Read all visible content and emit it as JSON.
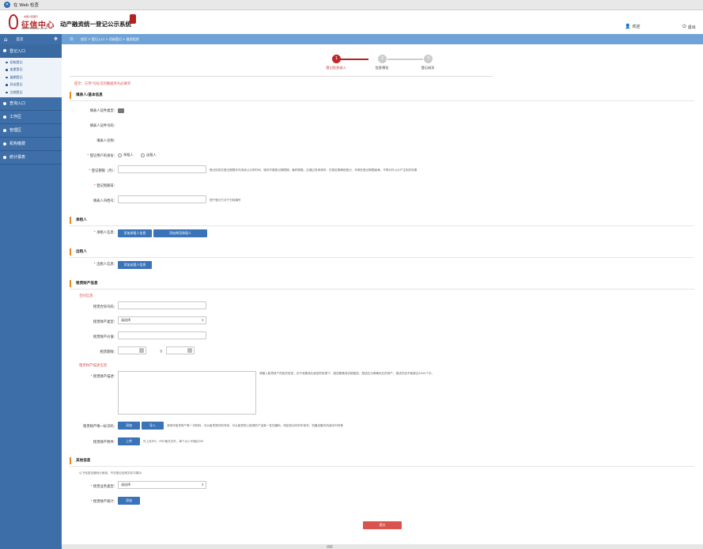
{
  "window": {
    "title": "在 Web 检查"
  },
  "header": {
    "logo_small": "中国人民银行",
    "logo_text": "征信中心",
    "logo_en": "CREDIT REFERENCE CENTER",
    "system_title": "动产融资统一登记公示系统",
    "user_label": "欢迎",
    "exit_label": "退出"
  },
  "nav": {
    "home_label": "首页",
    "breadcrumb": "首页 > 登记入口 > 初始登记 > 融资租赁"
  },
  "sidebar": {
    "groups": [
      {
        "label": "登记入口"
      },
      {
        "label": "查询入口"
      },
      {
        "label": "工作区"
      },
      {
        "label": "管理区"
      },
      {
        "label": "机构缴费"
      },
      {
        "label": "统计报表"
      }
    ],
    "sub_items": [
      {
        "label": "初始登记"
      },
      {
        "label": "变更登记"
      },
      {
        "label": "展期登记"
      },
      {
        "label": "异议登记"
      },
      {
        "label": "注销登记"
      }
    ]
  },
  "steps": [
    {
      "num": "1",
      "label": "登记信息录入"
    },
    {
      "num": "2",
      "label": "信息预览"
    },
    {
      "num": "3",
      "label": "登记成功"
    }
  ],
  "hint": "提示：方带*号标识的数据项为必填项",
  "sections": {
    "filler": "填表人/基本信息",
    "lessee": "承租人",
    "lessor": "出租人",
    "lease_property": "租赁财产信息",
    "other": "其他信息"
  },
  "filler": {
    "cert_type_label": "填表人证件类型：",
    "cert_no_label": "填表人证件号码：",
    "name_label": "填表人名称：",
    "role_label": "登记用户的身份：",
    "role_options": [
      "承租人",
      "出租人"
    ],
    "period_label": "登记期限（月）：",
    "period_help": "登记信息在登记期限年内持续公示的时间，服务开展登记期限期，最终期限。应通过查询请求，在规定期满前登记，本期在登记期限届满，不再对外公示产生相关效果",
    "expire_label": "登记到期日：",
    "ref_label": "填表人归档号：",
    "ref_help": "便于登记方对于归档编号"
  },
  "lessee": {
    "info_label": "承租人信息：",
    "btn_add_individual": "添加承租人信息",
    "btn_add_common": "添加常用承租人"
  },
  "lessor": {
    "info_label": "出租人信息：",
    "btn_add": "添加出租人信息"
  },
  "contract": {
    "sub_title": "合同信息",
    "contract_no_label": "租赁合同号码：",
    "type_label": "租赁财产类型：",
    "type_value": "请选择",
    "value_label": "租赁财产价值：",
    "term_label": "租赁期限：",
    "term_to": "至"
  },
  "property": {
    "sub_title": "租赁财产描述信息",
    "desc_label": "租赁财产描述：",
    "desc_help": "请输入租赁财产的相关信息，在不泄露商业秘密的前提下，描述要素或详细描述，描述应当明确对应的财产，描述内容不能超过4000个字。",
    "id_label": "租赁财产唯一标识码：",
    "btn_add": "添加",
    "btn_import": "导入",
    "id_help": "请填写租赁财产唯一识别码，可从租赁物识别号码，可从租赁物上取得的产品唯一性的编码，例如机动车的车架号、机器设备的机身序列号等",
    "attach_label": "租赁财产附件：",
    "btn_upload": "上传",
    "attach_help": "可上传JPG、PDF格式文件，单个大小不超过5M"
  },
  "other": {
    "note": "以下信息仅做统计使用，不在登记证明文件中展示",
    "biz_type_label": "租赁业务类型：",
    "biz_type_value": "请选择",
    "stat_label": "租赁财产统计：",
    "btn_add": "添加"
  },
  "submit_label": "提交",
  "colors": {
    "sidebar": "#3d6ea8",
    "nav": "#6fa2d6",
    "accent_red": "#c0282b",
    "button_blue": "#3a73b8",
    "section_bar": "#e88a1a"
  }
}
